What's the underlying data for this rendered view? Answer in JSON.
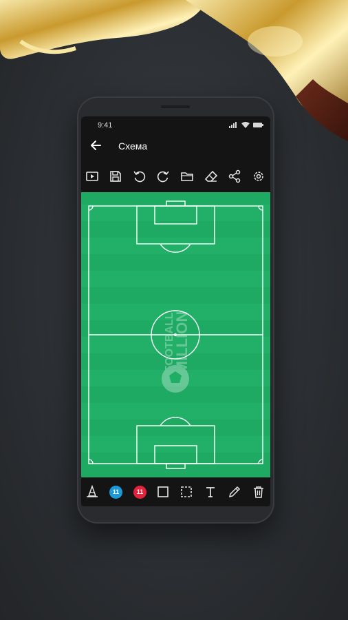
{
  "status": {
    "time": "9:41"
  },
  "appbar": {
    "title": "Схема"
  },
  "toolbar": {
    "items": [
      "video-icon",
      "save-icon",
      "undo-icon",
      "redo-icon",
      "folder-icon",
      "eraser-icon",
      "share-icon",
      "settings-icon"
    ]
  },
  "pitch": {
    "watermark_line1": "FOOTBALL",
    "watermark_line2": "MILLION"
  },
  "bottombar": {
    "team_blue_count": "11",
    "team_red_count": "11",
    "colors": {
      "team_blue": "#1a9bd8",
      "team_red": "#e3233c",
      "pitch": "#1faa64"
    }
  }
}
